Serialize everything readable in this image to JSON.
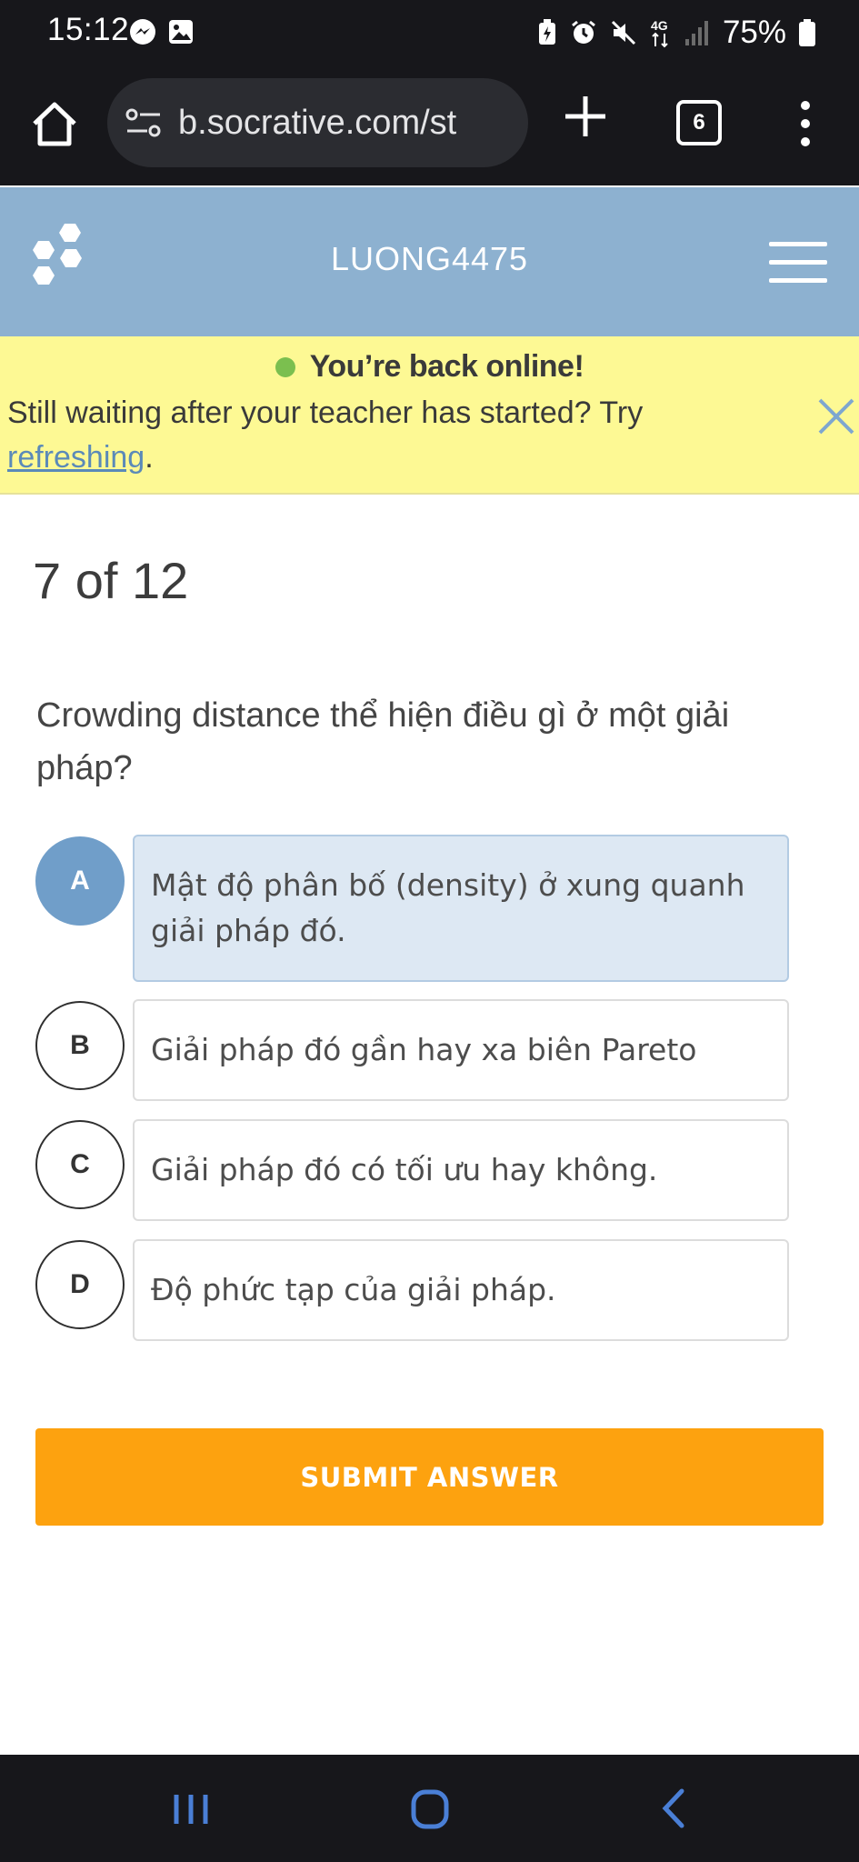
{
  "status_bar": {
    "time": "15:12",
    "battery": "75%",
    "network": "4G",
    "icons": [
      "messenger-icon",
      "gallery-icon",
      "battery-saver-icon",
      "alarm-icon",
      "mute-icon",
      "4g-icon",
      "signal-icon",
      "battery-icon"
    ]
  },
  "browser": {
    "url": "b.socrative.com/st",
    "tab_count": "6"
  },
  "header": {
    "room_name": "LUONG4475"
  },
  "banner": {
    "title": "You’re back online!",
    "message": "Still waiting after your teacher has started? Try ",
    "link": "refreshing",
    "message_end": ".",
    "dot_color": "#7bbf4f"
  },
  "quiz": {
    "progress": "7 of 12",
    "question": "Crowding distance thể hiện điều gì ở một giải pháp?",
    "selected": "A",
    "options": [
      {
        "letter": "A",
        "text": "Mật độ phân bố (density) ở xung quanh giải pháp đó."
      },
      {
        "letter": "B",
        "text": "Giải pháp đó gần hay xa biên Pareto"
      },
      {
        "letter": "C",
        "text": "Giải pháp đó có tối ưu hay không."
      },
      {
        "letter": "D",
        "text": "Độ phức tạp của giải pháp."
      }
    ],
    "submit_label": "SUBMIT ANSWER"
  },
  "colors": {
    "header_bg": "#8db1d0",
    "banner_bg": "#fdf994",
    "selected_option": "#709ec9",
    "submit_bg": "#fda20f",
    "nav_icon": "#4a7fd6"
  }
}
